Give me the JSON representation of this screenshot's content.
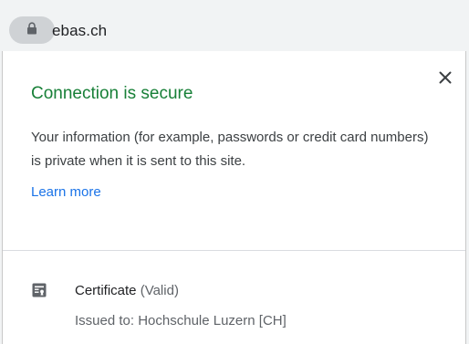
{
  "omnibox": {
    "url": "ebas.ch",
    "lock_icon": "lock-icon"
  },
  "popup": {
    "close_icon": "close-icon",
    "title": "Connection is secure",
    "description": "Your information (for example, passwords or credit card numbers) is private when it is sent to this site.",
    "learn_more": "Learn more",
    "certificate": {
      "icon": "certificate-icon",
      "label": "Certificate",
      "status": "(Valid)",
      "issued_to": "Issued to: Hochschule Luzern [CH]"
    }
  },
  "colors": {
    "secure_green": "#188038",
    "link_blue": "#1a73e8",
    "text": "#3c4043"
  }
}
